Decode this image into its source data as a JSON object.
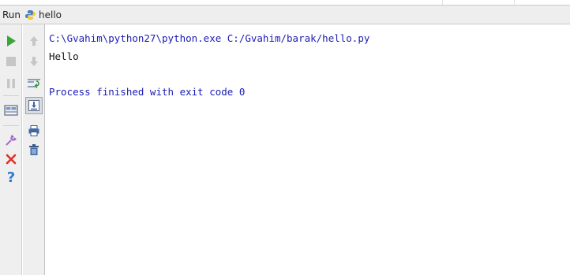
{
  "run_panel": {
    "title": "Run",
    "config_name": "hello",
    "config_icon": "python-icon"
  },
  "left_toolbar": [
    {
      "name": "rerun-icon",
      "tooltip": "Rerun"
    },
    {
      "name": "stop-icon",
      "tooltip": "Stop"
    },
    {
      "name": "pause-icon",
      "tooltip": "Pause"
    },
    {
      "name": "restore-layout-icon",
      "tooltip": "Restore layout"
    },
    {
      "name": "pin-icon",
      "tooltip": "Pin tab"
    },
    {
      "name": "close-icon",
      "tooltip": "Close"
    },
    {
      "name": "help-icon",
      "tooltip": "Help"
    }
  ],
  "right_toolbar": [
    {
      "name": "arrow-up-icon",
      "tooltip": "Up the stack trace"
    },
    {
      "name": "arrow-down-icon",
      "tooltip": "Down the stack trace"
    },
    {
      "name": "soft-wrap-icon",
      "tooltip": "Use soft wraps"
    },
    {
      "name": "scroll-to-end-icon",
      "tooltip": "Scroll to the end",
      "pressed": true
    },
    {
      "name": "print-icon",
      "tooltip": "Print"
    },
    {
      "name": "trash-icon",
      "tooltip": "Clear all"
    }
  ],
  "console": {
    "command": "C:\\Gvahim\\python27\\python.exe C:/Gvahim/barak/hello.py",
    "output": "Hello",
    "exit_message": "Process finished with exit code 0"
  },
  "colors": {
    "system_text": "#1b1bb4",
    "output_text": "#111111",
    "run_green": "#3aa63a",
    "close_red": "#e0302a",
    "help_blue": "#2a7ad8"
  }
}
